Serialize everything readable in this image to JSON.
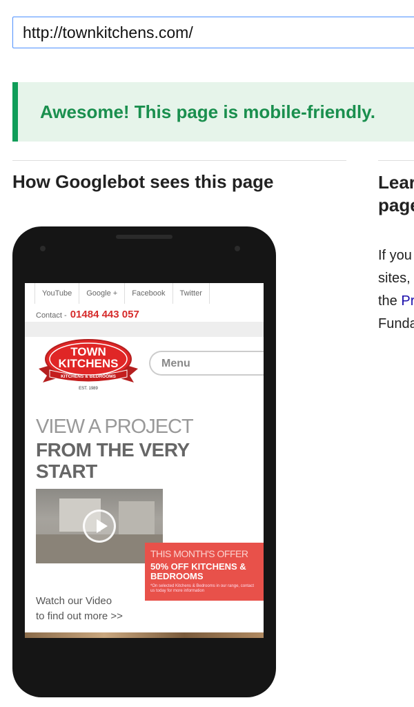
{
  "url": "http://townkitchens.com/",
  "banner": "Awesome! This page is mobile-friendly.",
  "heading": "How Googlebot sees this page",
  "right": {
    "title_line1": "Lear",
    "title_line2": "page",
    "body_line1": "If you",
    "body_line2": "sites,",
    "body_line3_prefix": "the ",
    "body_line3_link": "Pr",
    "body_line4": "Funda"
  },
  "phone_site": {
    "social": [
      "YouTube",
      "Google +",
      "Facebook",
      "Twitter"
    ],
    "contact_label": "Contact -",
    "contact_phone": "01484 443 057",
    "logo": {
      "line1": "TOWN",
      "line2": "KITCHENS",
      "ribbon": "KITCHENS & BEDROOMS",
      "est": "EST. 1989"
    },
    "menu_label": "Menu",
    "view_title": "VIEW A PROJECT",
    "big_title": "FROM THE VERY START",
    "offer_label": "THIS MONTH'S OFFER",
    "offer_main": "50% OFF KITCHENS & BEDROOMS",
    "offer_small": "*On selected Kitchens & Bedrooms in our range, contact us today for more information",
    "watch_line1": "Watch our Video",
    "watch_line2": "to find out more >>"
  },
  "colors": {
    "success_green": "#1a8f4e",
    "banner_bg": "#e6f4ea",
    "brand_red": "#d62b2b",
    "offer_bg": "#e8514a",
    "link_blue": "#1a0dab"
  }
}
